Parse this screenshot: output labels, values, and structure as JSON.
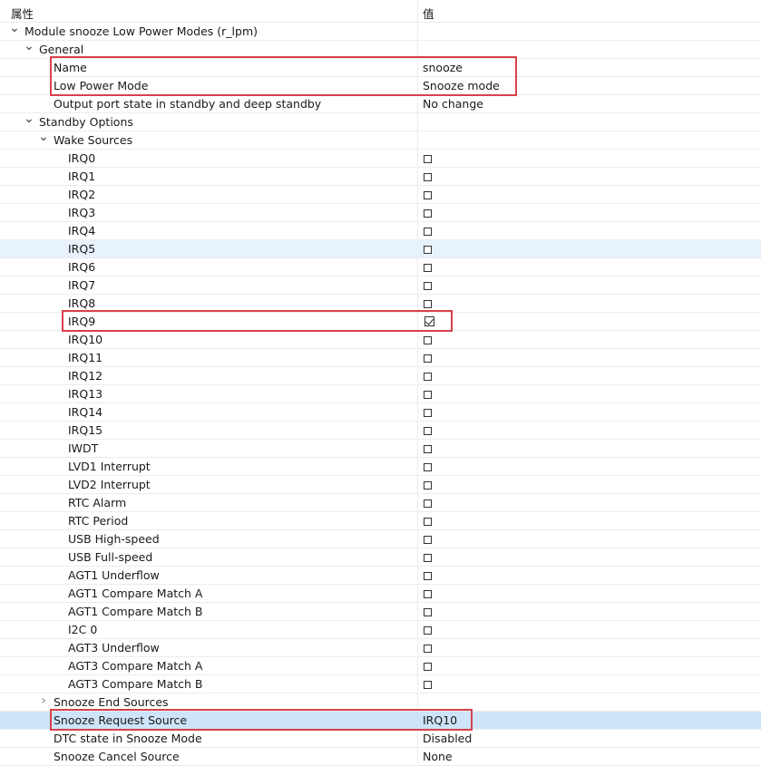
{
  "header": {
    "property_label": "属性",
    "value_label": "值"
  },
  "rows": [
    {
      "name": "module-node",
      "label": "Module snooze Low Power Modes (r_lpm)",
      "level": 0,
      "expander": "expanded",
      "value": ""
    },
    {
      "name": "general-node",
      "label": "General",
      "level": 1,
      "expander": "expanded",
      "value": ""
    },
    {
      "name": "name-property",
      "label": "Name",
      "level": 2,
      "value": "snooze"
    },
    {
      "name": "low-power-mode-property",
      "label": "Low Power Mode",
      "level": 2,
      "value": "Snooze mode"
    },
    {
      "name": "output-port-state-property",
      "label": "Output port state in standby and deep standby",
      "level": 2,
      "value": "No change"
    },
    {
      "name": "standby-options-node",
      "label": "Standby Options",
      "level": 1,
      "expander": "expanded",
      "value": ""
    },
    {
      "name": "wake-sources-node",
      "label": "Wake Sources",
      "level": 2,
      "expander": "expanded",
      "value": ""
    },
    {
      "name": "irq0-row",
      "label": "IRQ0",
      "level": 3,
      "checkbox": false
    },
    {
      "name": "irq1-row",
      "label": "IRQ1",
      "level": 3,
      "checkbox": false
    },
    {
      "name": "irq2-row",
      "label": "IRQ2",
      "level": 3,
      "checkbox": false
    },
    {
      "name": "irq3-row",
      "label": "IRQ3",
      "level": 3,
      "checkbox": false
    },
    {
      "name": "irq4-row",
      "label": "IRQ4",
      "level": 3,
      "checkbox": false
    },
    {
      "name": "irq5-row",
      "label": "IRQ5",
      "level": 3,
      "checkbox": false,
      "state": "hover"
    },
    {
      "name": "irq6-row",
      "label": "IRQ6",
      "level": 3,
      "checkbox": false
    },
    {
      "name": "irq7-row",
      "label": "IRQ7",
      "level": 3,
      "checkbox": false
    },
    {
      "name": "irq8-row",
      "label": "IRQ8",
      "level": 3,
      "checkbox": false
    },
    {
      "name": "irq9-row",
      "label": "IRQ9",
      "level": 3,
      "checkbox": true
    },
    {
      "name": "irq10-row",
      "label": "IRQ10",
      "level": 3,
      "checkbox": false
    },
    {
      "name": "irq11-row",
      "label": "IRQ11",
      "level": 3,
      "checkbox": false
    },
    {
      "name": "irq12-row",
      "label": "IRQ12",
      "level": 3,
      "checkbox": false
    },
    {
      "name": "irq13-row",
      "label": "IRQ13",
      "level": 3,
      "checkbox": false
    },
    {
      "name": "irq14-row",
      "label": "IRQ14",
      "level": 3,
      "checkbox": false
    },
    {
      "name": "irq15-row",
      "label": "IRQ15",
      "level": 3,
      "checkbox": false
    },
    {
      "name": "iwdt-row",
      "label": "IWDT",
      "level": 3,
      "checkbox": false
    },
    {
      "name": "lvd1-interrupt-row",
      "label": "LVD1 Interrupt",
      "level": 3,
      "checkbox": false
    },
    {
      "name": "lvd2-interrupt-row",
      "label": "LVD2 Interrupt",
      "level": 3,
      "checkbox": false
    },
    {
      "name": "rtc-alarm-row",
      "label": "RTC Alarm",
      "level": 3,
      "checkbox": false
    },
    {
      "name": "rtc-period-row",
      "label": "RTC Period",
      "level": 3,
      "checkbox": false
    },
    {
      "name": "usb-high-speed-row",
      "label": "USB High-speed",
      "level": 3,
      "checkbox": false
    },
    {
      "name": "usb-full-speed-row",
      "label": "USB Full-speed",
      "level": 3,
      "checkbox": false
    },
    {
      "name": "agt1-underflow-row",
      "label": "AGT1 Underflow",
      "level": 3,
      "checkbox": false
    },
    {
      "name": "agt1-compare-match-a-row",
      "label": "AGT1 Compare Match A",
      "level": 3,
      "checkbox": false
    },
    {
      "name": "agt1-compare-match-b-row",
      "label": "AGT1 Compare Match B",
      "level": 3,
      "checkbox": false
    },
    {
      "name": "i2c0-row",
      "label": "I2C 0",
      "level": 3,
      "checkbox": false
    },
    {
      "name": "agt3-underflow-row",
      "label": "AGT3 Underflow",
      "level": 3,
      "checkbox": false
    },
    {
      "name": "agt3-compare-match-a-row",
      "label": "AGT3 Compare Match A",
      "level": 3,
      "checkbox": false
    },
    {
      "name": "agt3-compare-match-b-row",
      "label": "AGT3 Compare Match B",
      "level": 3,
      "checkbox": false
    },
    {
      "name": "snooze-end-sources-node",
      "label": "Snooze End Sources",
      "level": 2,
      "expander": "collapsed",
      "value": ""
    },
    {
      "name": "snooze-request-source-property",
      "label": "Snooze Request Source",
      "level": 2,
      "value": "IRQ10",
      "state": "selected"
    },
    {
      "name": "dtc-state-property",
      "label": "DTC state in Snooze Mode",
      "level": 2,
      "value": "Disabled"
    },
    {
      "name": "snooze-cancel-source-property",
      "label": "Snooze Cancel Source",
      "level": 2,
      "value": "None"
    }
  ],
  "colors": {
    "highlight_border": "#d9414c",
    "hover_row": "#e8f2fc",
    "selected_row": "#cde4f9"
  },
  "icons": {
    "expanded": "chevron-down-icon",
    "collapsed": "chevron-right-icon"
  }
}
